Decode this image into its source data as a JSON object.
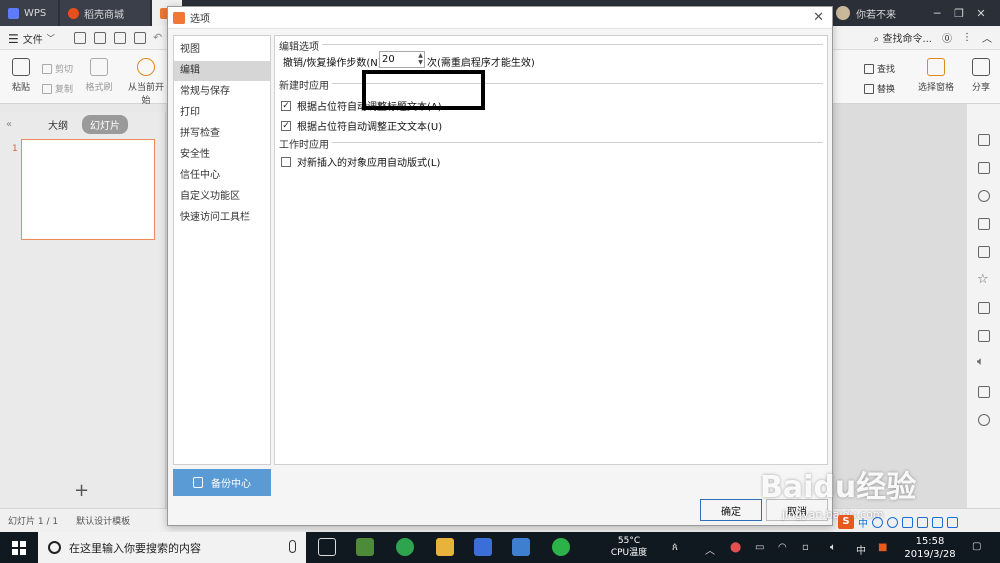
{
  "tabs": {
    "wps": "WPS",
    "docer": "稻壳商城"
  },
  "user": {
    "name": "你若不来"
  },
  "menu": {
    "file": "文件",
    "search_cmd": "查找命令..."
  },
  "ribbon": {
    "paste": "粘贴",
    "cut": "剪切",
    "copy": "复制",
    "format_painter": "格式刷",
    "from_current": "从当前开始",
    "find": "查找",
    "replace": "替换",
    "select_pane": "选择窗格",
    "share": "分享"
  },
  "left_panel": {
    "tab_outline": "大纲",
    "tab_slides": "幻灯片",
    "slide_number": "1"
  },
  "status": {
    "slide_count": "幻灯片 1 / 1",
    "template": "默认设计模板"
  },
  "dialog": {
    "title": "选项",
    "nav": [
      "视图",
      "编辑",
      "常规与保存",
      "打印",
      "拼写检查",
      "安全性",
      "信任中心",
      "自定义功能区",
      "快速访问工具栏"
    ],
    "backup": "备份中心",
    "group_edit": "编辑选项",
    "undo_label": "撤销/恢复操作步数(N):",
    "undo_value": "20",
    "undo_note": "次(需重启程序才能生效)",
    "group_apply": "新建时应用",
    "check1": "根据占位符自动调整标题文本(A)",
    "check2": "根据占位符自动调整正文文本(U)",
    "group_work": "工作时应用",
    "check3": "对新插入的对象应用自动版式(L)",
    "ok": "确定",
    "cancel": "取消"
  },
  "watermark": {
    "brand": "Baidu经验",
    "url": "jingyan.baidu.com"
  },
  "taskbar": {
    "search_placeholder": "在这里输入你要搜索的内容",
    "cpu_value": "55°C",
    "cpu_label": "CPU温度",
    "ime": "中",
    "time": "15:58",
    "date": "2019/3/28"
  },
  "colors": {
    "accent": "#f07834",
    "selection": "#5b9bd5",
    "taskbar": "#101820"
  }
}
